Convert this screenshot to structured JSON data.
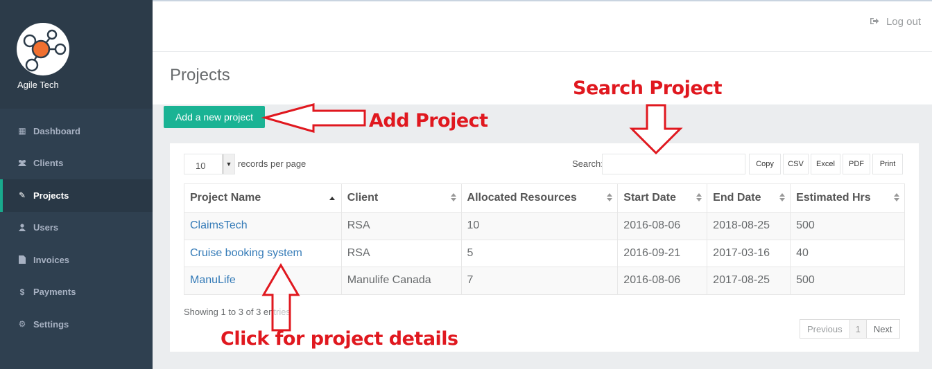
{
  "app": {
    "brand_name": "Agile Tech"
  },
  "header": {
    "logout_label": "Log out"
  },
  "sidebar": {
    "items": [
      {
        "label": "Dashboard",
        "icon": "th-large-icon",
        "glyph": "▦"
      },
      {
        "label": "Clients",
        "icon": "users-icon",
        "glyph": "👥"
      },
      {
        "label": "Projects",
        "icon": "pencil-icon",
        "glyph": "✎",
        "active": true
      },
      {
        "label": "Users",
        "icon": "user-icon",
        "glyph": "●"
      },
      {
        "label": "Invoices",
        "icon": "file-icon",
        "glyph": "▮"
      },
      {
        "label": "Payments",
        "icon": "dollar-icon",
        "glyph": "$"
      },
      {
        "label": "Settings",
        "icon": "gear-icon",
        "glyph": "⚙"
      }
    ]
  },
  "page": {
    "title": "Projects",
    "add_button_label": "Add a new project"
  },
  "table_controls": {
    "records_per_page_value": "10",
    "records_per_page_label": "records per page",
    "search_label": "Search:",
    "search_value": "",
    "export_buttons": [
      "Copy",
      "CSV",
      "Excel",
      "PDF",
      "Print"
    ]
  },
  "table": {
    "columns": [
      "Project Name",
      "Client",
      "Allocated Resources",
      "Start Date",
      "End Date",
      "Estimated Hrs"
    ],
    "rows": [
      [
        "ClaimsTech",
        "RSA",
        "10",
        "2016-08-06",
        "2018-08-25",
        "500"
      ],
      [
        "Cruise booking system",
        "RSA",
        "5",
        "2016-09-21",
        "2017-03-16",
        "40"
      ],
      [
        "ManuLife",
        "Manulife Canada",
        "7",
        "2016-08-06",
        "2017-08-25",
        "500"
      ]
    ],
    "info": "Showing 1 to 3 of 3 entries"
  },
  "pagination": {
    "previous": "Previous",
    "current": "1",
    "next": "Next"
  },
  "annotations": {
    "search": "Search Project",
    "add": "Add Project",
    "click": "Click  for project details"
  },
  "colors": {
    "sidebar": "#2f4050",
    "accent": "#1ab394",
    "annotation": "#e0181f",
    "link": "#337ab7"
  }
}
